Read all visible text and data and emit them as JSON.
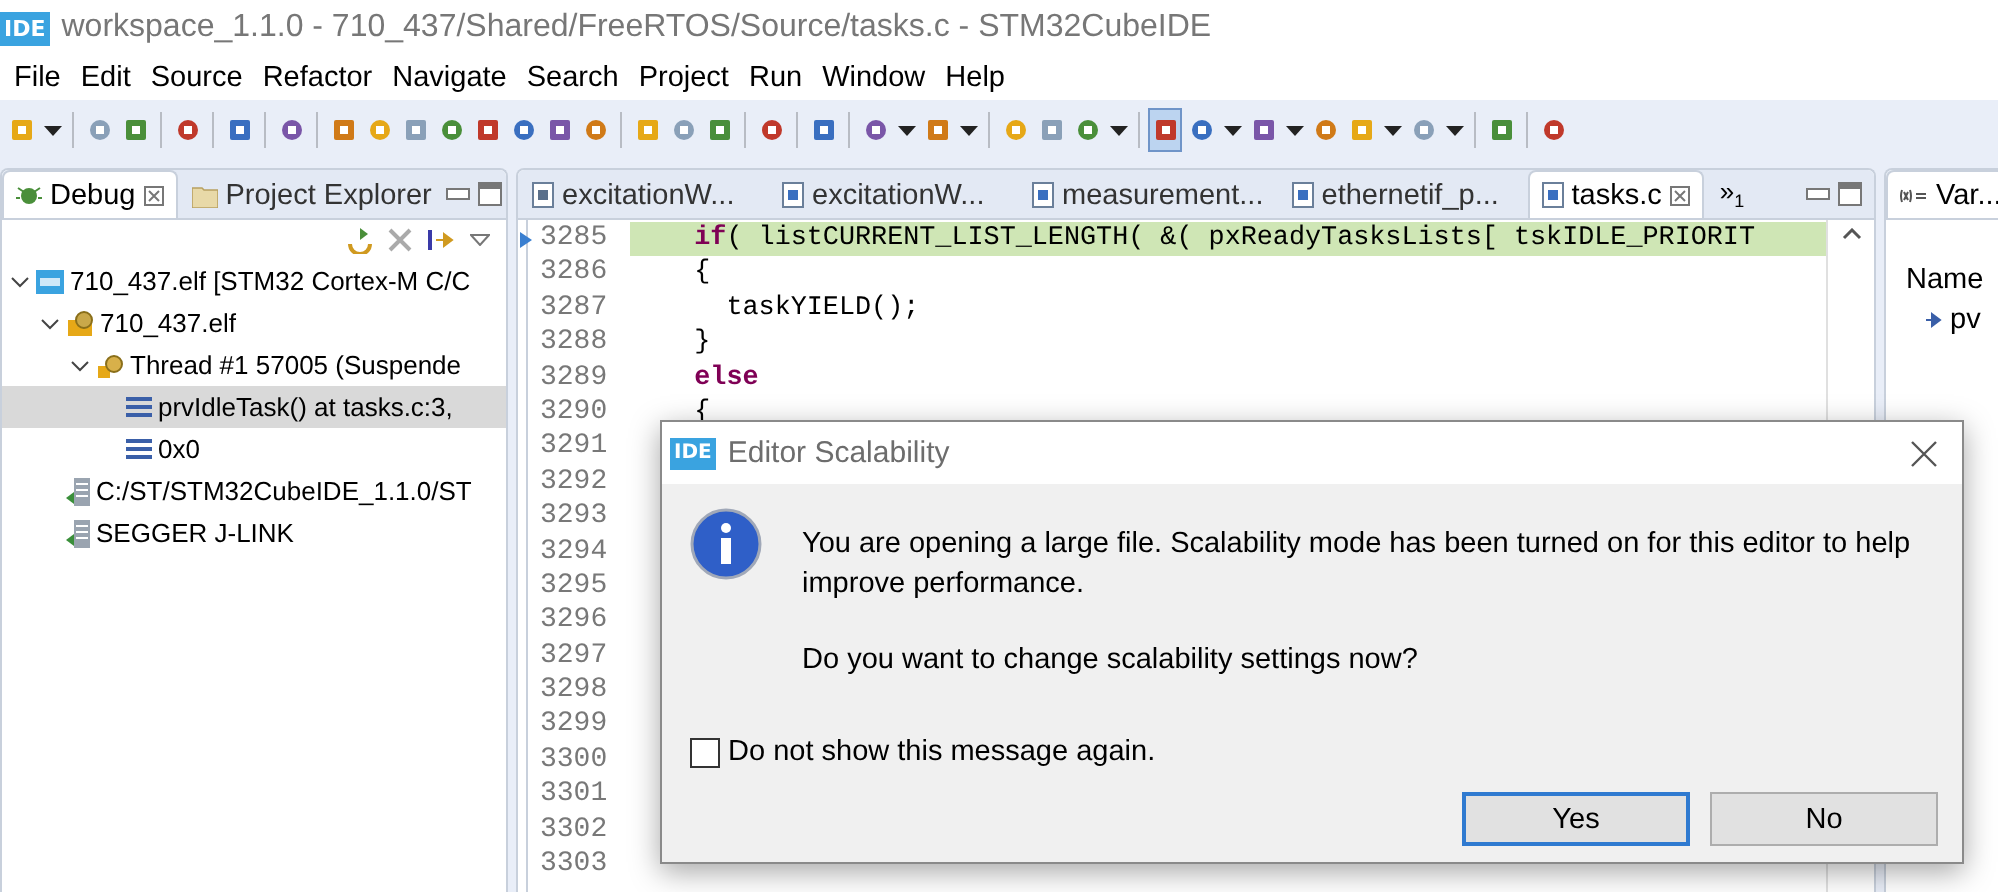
{
  "window": {
    "icon_text": "IDE",
    "title": "workspace_1.1.0 - 710_437/Shared/FreeRTOS/Source/tasks.c - STM32CubeIDE"
  },
  "menu": [
    "File",
    "Edit",
    "Source",
    "Refactor",
    "Navigate",
    "Search",
    "Project",
    "Run",
    "Window",
    "Help"
  ],
  "toolbar": [
    {
      "kind": "tool",
      "pressed": false
    },
    {
      "kind": "caret"
    },
    {
      "kind": "separator"
    },
    {
      "kind": "tool",
      "pressed": false
    },
    {
      "kind": "tool",
      "pressed": false
    },
    {
      "kind": "separator"
    },
    {
      "kind": "tool",
      "pressed": false
    },
    {
      "kind": "separator"
    },
    {
      "kind": "tool",
      "pressed": false
    },
    {
      "kind": "separator"
    },
    {
      "kind": "tool",
      "pressed": false
    },
    {
      "kind": "separator"
    },
    {
      "kind": "tool",
      "pressed": false
    },
    {
      "kind": "tool",
      "pressed": false
    },
    {
      "kind": "tool",
      "pressed": false
    },
    {
      "kind": "tool",
      "pressed": false
    },
    {
      "kind": "tool",
      "pressed": false
    },
    {
      "kind": "tool",
      "pressed": false
    },
    {
      "kind": "tool",
      "pressed": false
    },
    {
      "kind": "tool",
      "pressed": false
    },
    {
      "kind": "separator"
    },
    {
      "kind": "tool",
      "pressed": false
    },
    {
      "kind": "tool",
      "pressed": false
    },
    {
      "kind": "tool",
      "pressed": false
    },
    {
      "kind": "separator"
    },
    {
      "kind": "tool",
      "pressed": false
    },
    {
      "kind": "separator"
    },
    {
      "kind": "tool",
      "pressed": false
    },
    {
      "kind": "separator"
    },
    {
      "kind": "tool",
      "pressed": false
    },
    {
      "kind": "caret"
    },
    {
      "kind": "tool",
      "pressed": false
    },
    {
      "kind": "caret"
    },
    {
      "kind": "separator"
    },
    {
      "kind": "tool",
      "pressed": false
    },
    {
      "kind": "tool",
      "pressed": false
    },
    {
      "kind": "tool",
      "pressed": false
    },
    {
      "kind": "caret"
    },
    {
      "kind": "separator"
    },
    {
      "kind": "tool",
      "pressed": true
    },
    {
      "kind": "tool",
      "pressed": false
    },
    {
      "kind": "caret"
    },
    {
      "kind": "tool",
      "pressed": false
    },
    {
      "kind": "caret"
    },
    {
      "kind": "tool",
      "pressed": false
    },
    {
      "kind": "tool",
      "pressed": false
    },
    {
      "kind": "caret"
    },
    {
      "kind": "tool",
      "pressed": false
    },
    {
      "kind": "caret"
    },
    {
      "kind": "separator"
    },
    {
      "kind": "tool",
      "pressed": false
    },
    {
      "kind": "separator"
    },
    {
      "kind": "tool",
      "pressed": false
    }
  ],
  "left_panel": {
    "tabs": [
      {
        "label": "Debug",
        "selected": true
      },
      {
        "label": "Project Explorer",
        "selected": false
      }
    ],
    "tree": [
      {
        "label": "710_437.elf [STM32 Cortex-M C/C",
        "kind": "launch",
        "expanded": true,
        "selected": false,
        "children": [
          {
            "label": "710_437.elf",
            "kind": "process",
            "expanded": true,
            "selected": false,
            "children": [
              {
                "label": "Thread #1 57005 (Suspende",
                "kind": "thread",
                "expanded": true,
                "selected": false,
                "children": [
                  {
                    "label": "prvIdleTask() at tasks.c:3,",
                    "kind": "frame",
                    "selected": true
                  },
                  {
                    "label": "0x0",
                    "kind": "frame",
                    "selected": false
                  }
                ]
              }
            ]
          },
          {
            "label": "C:/ST/STM32CubeIDE_1.1.0/ST",
            "kind": "server",
            "selected": false
          },
          {
            "label": "SEGGER J-LINK",
            "kind": "server",
            "selected": false
          }
        ]
      }
    ]
  },
  "editor": {
    "tabs": [
      {
        "label": "excitationW...",
        "kind": "header",
        "selected": false
      },
      {
        "label": "excitationW...",
        "kind": "source",
        "selected": false
      },
      {
        "label": "measurement...",
        "kind": "source",
        "selected": false
      },
      {
        "label": "ethernetif_p...",
        "kind": "source",
        "selected": false
      },
      {
        "label": "tasks.c",
        "kind": "source",
        "selected": true
      }
    ],
    "overflow": {
      "symbol": "»",
      "count": "1"
    },
    "lines": [
      {
        "number": "3285",
        "current": true,
        "segments": [
          {
            "text": "if",
            "kind": "keyword"
          },
          {
            "text": "( listCURRENT_LIST_LENGTH( &( pxReadyTasksLists[ tskIDLE_PRIORIT",
            "kind": "plain"
          }
        ]
      },
      {
        "number": "3286",
        "current": false,
        "segments": [
          {
            "text": "{",
            "kind": "plain"
          }
        ]
      },
      {
        "number": "3287",
        "current": false,
        "segments": [
          {
            "text": "  taskYIELD();",
            "kind": "plain"
          }
        ]
      },
      {
        "number": "3288",
        "current": false,
        "segments": [
          {
            "text": "}",
            "kind": "plain"
          }
        ]
      },
      {
        "number": "3289",
        "current": false,
        "segments": [
          {
            "text": "else",
            "kind": "keyword"
          }
        ]
      },
      {
        "number": "3290",
        "current": false,
        "segments": [
          {
            "text": "{",
            "kind": "plain"
          }
        ]
      },
      {
        "number": "3291",
        "current": false
      },
      {
        "number": "3292",
        "current": false
      },
      {
        "number": "3293",
        "current": false
      },
      {
        "number": "3294",
        "current": false
      },
      {
        "number": "3295",
        "current": false
      },
      {
        "number": "3296",
        "current": false
      },
      {
        "number": "3297",
        "current": false
      },
      {
        "number": "3298",
        "current": false
      },
      {
        "number": "3299",
        "current": false
      },
      {
        "number": "3300",
        "current": false
      },
      {
        "number": "3301",
        "current": false
      },
      {
        "number": "3302",
        "current": false
      },
      {
        "number": "3303",
        "current": false
      }
    ]
  },
  "right_panel": {
    "tab": {
      "label": "Var...",
      "selected": true
    },
    "column": "Name",
    "rows": [
      "pv"
    ]
  },
  "dialog": {
    "icon_text": "IDE",
    "title": "Editor Scalability",
    "message": "You are opening a large file. Scalability mode has been turned on for this editor to help improve performance.",
    "question": "Do you want to change scalability settings now?",
    "checkbox": {
      "label": "Do not show this message again.",
      "checked": false
    },
    "buttons": [
      {
        "label": "Yes",
        "default": true
      },
      {
        "label": "No",
        "default": false
      }
    ]
  }
}
